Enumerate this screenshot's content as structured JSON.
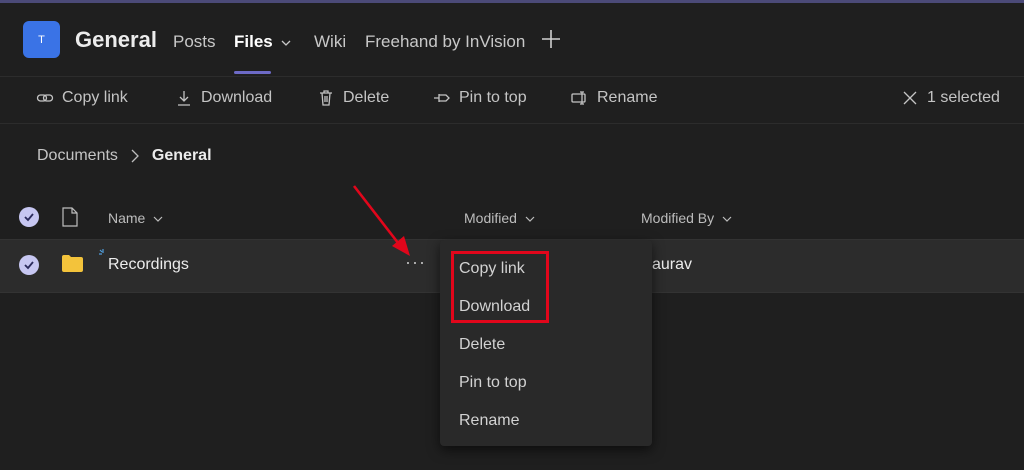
{
  "header": {
    "team_initial": "T",
    "channel": "General",
    "tabs": [
      {
        "label": "Posts"
      },
      {
        "label": "Files"
      },
      {
        "label": "Wiki"
      },
      {
        "label": "Freehand by InVision"
      }
    ]
  },
  "toolbar": {
    "copy_link": "Copy link",
    "download": "Download",
    "delete": "Delete",
    "pin_to_top": "Pin to top",
    "rename": "Rename",
    "selected": "1 selected"
  },
  "breadcrumb": {
    "root": "Documents",
    "current": "General"
  },
  "table": {
    "columns": {
      "name": "Name",
      "modified": "Modified",
      "modified_by": "Modified By"
    },
    "rows": [
      {
        "name": "Recordings",
        "modified_by": "aurav"
      }
    ]
  },
  "context_menu": {
    "items": [
      "Copy link",
      "Download",
      "Delete",
      "Pin to top",
      "Rename"
    ]
  },
  "colors": {
    "accent": "#6d6ac6",
    "team_avatar": "#3a73e6",
    "folder": "#f3c33b",
    "annotation_red": "#e1061b"
  }
}
